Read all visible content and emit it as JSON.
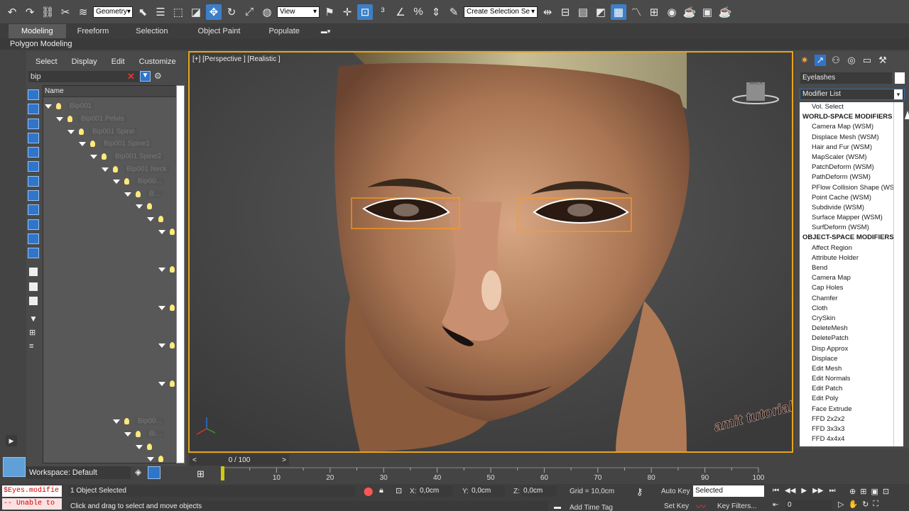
{
  "toolbar": {
    "selection_filter": "Geometry",
    "ref_coord": "View",
    "named_selection_placeholder": "Create Selection Se"
  },
  "ribbon": {
    "tabs": [
      "Modeling",
      "Freeform",
      "Selection",
      "Object Paint",
      "Populate"
    ],
    "active_tab": "Modeling",
    "sub_label": "Polygon Modeling"
  },
  "explorer": {
    "menu": [
      "Select",
      "Display",
      "Edit",
      "Customize"
    ],
    "search_value": "bip",
    "column_header": "Name",
    "rows": [
      "Bip001",
      "Bip001 Pelvis",
      "Bip001 Spine",
      "Bip001 Spine1",
      "Bip001 Spine2",
      "Bip001 Neck",
      "Bip00...",
      "B...",
      "",
      "",
      "",
      "Bip00...",
      "Bi...",
      ""
    ],
    "workspace": "Workspace: Default"
  },
  "viewport": {
    "label": "[+] [Perspective ] [Realistic ]",
    "viewcube": "BACK",
    "watermark": "amit tutorial"
  },
  "command_panel": {
    "object_name": "Eyelashes",
    "modifier_list": "Modifier List",
    "items": [
      {
        "t": "item",
        "label": "Vol. Select"
      },
      {
        "t": "header",
        "label": "WORLD-SPACE MODIFIERS"
      },
      {
        "t": "item",
        "label": "Camera Map (WSM)"
      },
      {
        "t": "item",
        "label": "Displace Mesh (WSM)"
      },
      {
        "t": "item",
        "label": "Hair and Fur (WSM)"
      },
      {
        "t": "item",
        "label": "MapScaler (WSM)"
      },
      {
        "t": "item",
        "label": "PatchDeform (WSM)"
      },
      {
        "t": "item",
        "label": "PathDeform (WSM)"
      },
      {
        "t": "item",
        "label": "PFlow Collision Shape (WSM)"
      },
      {
        "t": "item",
        "label": "Point Cache (WSM)"
      },
      {
        "t": "item",
        "label": "Subdivide (WSM)"
      },
      {
        "t": "item",
        "label": "Surface Mapper (WSM)"
      },
      {
        "t": "item",
        "label": "SurfDeform (WSM)"
      },
      {
        "t": "header",
        "label": "OBJECT-SPACE MODIFIERS"
      },
      {
        "t": "item",
        "label": "Affect Region"
      },
      {
        "t": "item",
        "label": "Attribute Holder"
      },
      {
        "t": "item",
        "label": "Bend"
      },
      {
        "t": "item",
        "label": "Camera Map"
      },
      {
        "t": "item",
        "label": "Cap Holes"
      },
      {
        "t": "item",
        "label": "Chamfer"
      },
      {
        "t": "item",
        "label": "Cloth"
      },
      {
        "t": "item",
        "label": "CrySkin"
      },
      {
        "t": "item",
        "label": "DeleteMesh"
      },
      {
        "t": "item",
        "label": "DeletePatch"
      },
      {
        "t": "item",
        "label": "Disp Approx"
      },
      {
        "t": "item",
        "label": "Displace"
      },
      {
        "t": "item",
        "label": "Edit Mesh"
      },
      {
        "t": "item",
        "label": "Edit Normals"
      },
      {
        "t": "item",
        "label": "Edit Patch"
      },
      {
        "t": "item",
        "label": "Edit Poly"
      },
      {
        "t": "item",
        "label": "Face Extrude"
      },
      {
        "t": "item",
        "label": "FFD 2x2x2"
      },
      {
        "t": "item",
        "label": "FFD 3x3x3"
      },
      {
        "t": "item",
        "label": "FFD 4x4x4"
      }
    ]
  },
  "timeline": {
    "frame": "0 / 100",
    "prev": "<",
    "next": ">",
    "ticks": [
      "10",
      "20",
      "30",
      "40",
      "50",
      "60",
      "70",
      "80",
      "90",
      "100"
    ]
  },
  "status": {
    "maxscript_line1": "$Eyes.modifie",
    "maxscript_line2": "-- Unable to c",
    "selected": "1 Object Selected",
    "prompt": "Click and drag to select and move objects",
    "x_label": "X:",
    "x_value": "0,0cm",
    "y_label": "Y:",
    "y_value": "0,0cm",
    "z_label": "Z:",
    "z_value": "0,0cm",
    "grid": "Grid = 10,0cm",
    "add_time_tag": "Add Time Tag",
    "auto_key": "Auto Key",
    "set_key": "Set Key",
    "key_mode": "Selected",
    "key_filters": "Key Filters...",
    "frame_field": "0"
  },
  "colors": {
    "accent": "#3d7fc7",
    "viewport_border": "#e8a419",
    "selection": "#ff9a1a"
  }
}
